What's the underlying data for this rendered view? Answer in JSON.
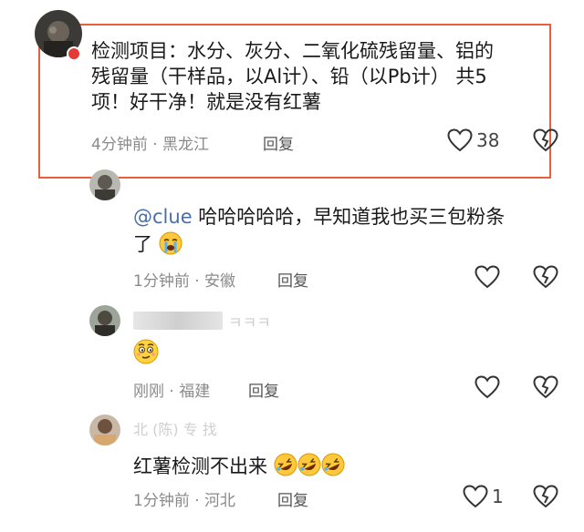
{
  "comments": [
    {
      "text": "检测项目：水分、灰分、二氧化硫残留量、铝的残留量（干样品，以Al计）、铅（以Pb计）共5项！好干净！就是没有红薯",
      "lines": [
        "检测项目：水分、灰分、二氧化硫残留量、铝的",
        "残留量（干样品，以Al计）、铅（以Pb计） 共5",
        "项！好干净！就是没有红薯"
      ],
      "time": "4分钟前",
      "location": "黑龙江",
      "reply_label": "回复",
      "likes": "38"
    },
    {
      "mention": "@clue",
      "text_line1": " 哈哈哈哈哈，早知道我也买三包粉条",
      "text_line2": "了",
      "emoji": "loudly-crying-face",
      "time": "1分钟前",
      "location": "安徽",
      "reply_label": "回复"
    },
    {
      "name_fragment": "ㅋㅋㅋ",
      "emoji": "smiling-face-with-raised-eyebrows",
      "time": "刚刚",
      "location": "福建",
      "reply_label": "回复"
    },
    {
      "name_fragment": "北 (陈) 专 找",
      "text": "红薯检测不出来",
      "emoji": "rolling-on-the-floor-laughing",
      "time": "1分钟前",
      "location": "河北",
      "reply_label": "回复",
      "likes": "1"
    }
  ],
  "separator": "·",
  "colors": {
    "highlight": "#e8603a",
    "mention": "#4a6fa5",
    "meta": "#8a8a8a"
  }
}
